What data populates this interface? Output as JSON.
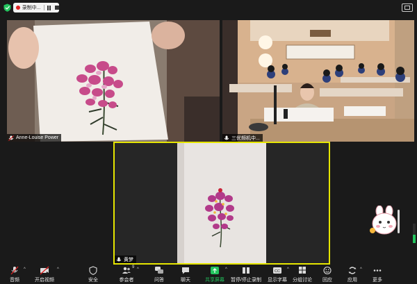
{
  "topbar": {
    "recording_label": "录制中...",
    "view_icon": "gallery-view-icon"
  },
  "participants": [
    {
      "name": "Anne-Louise Power"
    },
    {
      "name": "三优频机中..."
    },
    {
      "name": "黄梦"
    }
  ],
  "toolbar": {
    "items": [
      {
        "label": "音频",
        "icon": "microphone-muted-icon"
      },
      {
        "label": "开启视频",
        "icon": "video-off-icon"
      },
      {
        "label": "安全",
        "icon": "shield-icon"
      },
      {
        "label": "参会者",
        "icon": "participants-icon",
        "count": "9"
      },
      {
        "label": "问答",
        "icon": "qa-icon"
      },
      {
        "label": "聊天",
        "icon": "chat-icon"
      },
      {
        "label": "共享屏幕",
        "icon": "share-screen-icon"
      },
      {
        "label": "暂停/停止录制",
        "icon": "record-pause-icon"
      },
      {
        "label": "显示字幕",
        "icon": "captions-icon"
      },
      {
        "label": "分组讨论",
        "icon": "breakout-icon"
      },
      {
        "label": "回应",
        "icon": "reaction-icon"
      },
      {
        "label": "应用",
        "icon": "apps-icon"
      },
      {
        "label": "更多",
        "icon": "more-icon"
      }
    ]
  },
  "colors": {
    "accent_green": "#23c45e",
    "active_speaker_border": "#e6e600",
    "recording_red": "#e02424",
    "background": "#1a1a1a"
  }
}
